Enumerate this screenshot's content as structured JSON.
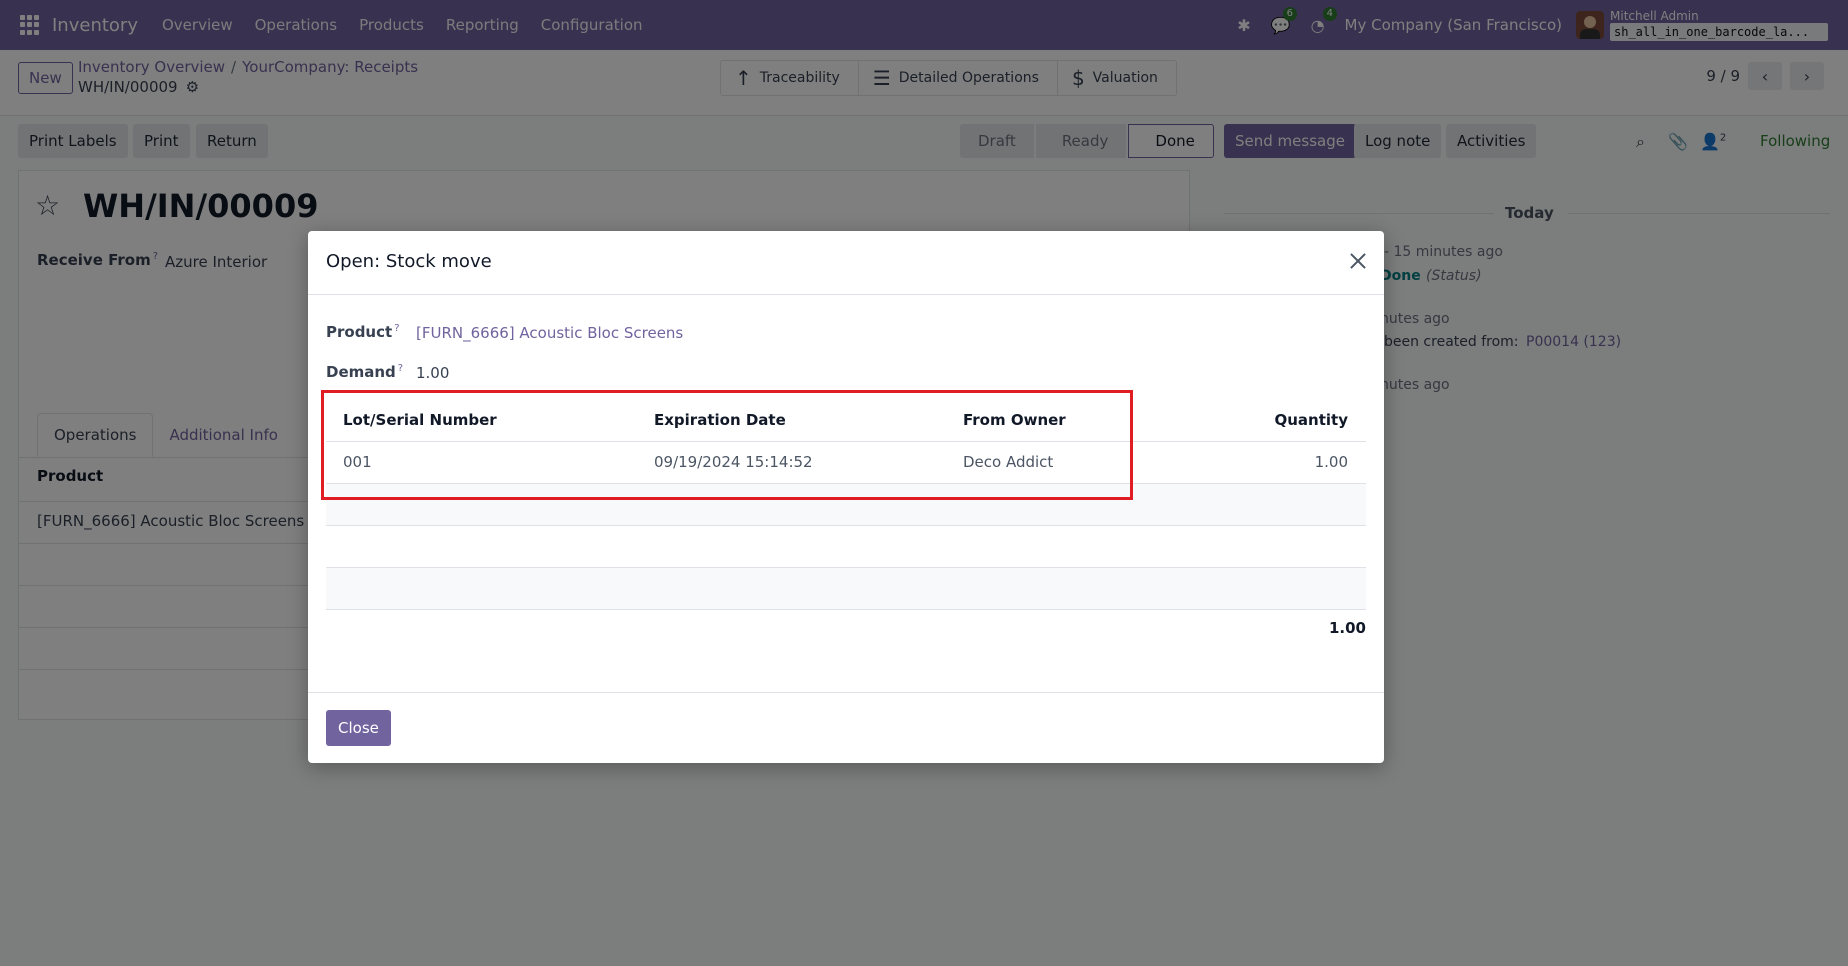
{
  "navbar": {
    "app_name": "Inventory",
    "menu": [
      "Overview",
      "Operations",
      "Products",
      "Reporting",
      "Configuration"
    ],
    "messages_count": "6",
    "activities_count": "4",
    "company": "My Company (San Francisco)",
    "user_name": "Mitchell Admin",
    "database": "sh_all_in_one_barcode_la..."
  },
  "control": {
    "new_label": "New",
    "breadcrumb": [
      "Inventory Overview",
      "YourCompany: Receipts"
    ],
    "breadcrumb_sep": "/",
    "record": "WH/IN/00009",
    "smart_buttons": [
      "Traceability",
      "Detailed Operations",
      "Valuation"
    ],
    "pager": "9 / 9"
  },
  "actions": {
    "print_labels": "Print Labels",
    "print": "Print",
    "return": "Return",
    "statuses": [
      "Draft",
      "Ready",
      "Done"
    ]
  },
  "chatter": {
    "send_message": "Send message",
    "log_note": "Log note",
    "activities": "Activities",
    "followers_count": "2",
    "following": "Following",
    "today": "Today",
    "line1_time": "- 15 minutes ago",
    "line1_done": "Done",
    "line1_status": "(Status)",
    "line2_time": "nutes ago",
    "line2_text": "been created from:",
    "line2_link": "P00014 (123)",
    "line3_time": "nutes ago"
  },
  "form": {
    "title": "WH/IN/00009",
    "receive_from_label": "Receive From",
    "help_mark": "?",
    "receive_from_value": "Azure Interior",
    "tabs": [
      "Operations",
      "Additional Info"
    ],
    "col_product": "Product",
    "row_product": "[FURN_6666] Acoustic Bloc Screens"
  },
  "modal": {
    "title": "Open: Stock move",
    "product_label": "Product",
    "product_value": "[FURN_6666] Acoustic Bloc Screens",
    "demand_label": "Demand",
    "demand_value": "1.00",
    "columns": [
      "Lot/Serial Number",
      "Expiration Date",
      "From Owner",
      "Quantity"
    ],
    "rows": [
      {
        "lot": "001",
        "expiration": "09/19/2024 15:14:52",
        "owner": "Deco Addict",
        "quantity": "1.00"
      }
    ],
    "total": "1.00",
    "close_label": "Close"
  },
  "colors": {
    "brand": "#71639e",
    "highlight": "#e11d24",
    "following": "#2e7d32"
  }
}
